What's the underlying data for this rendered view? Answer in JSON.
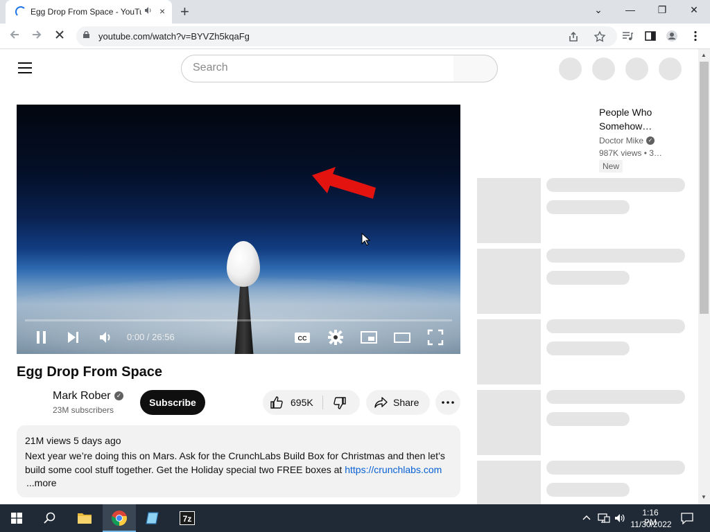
{
  "browser": {
    "tab_title": "Egg Drop From Space - YouTube",
    "tab_close": "×",
    "new_tab": "+",
    "url": "youtube.com/watch?v=BYVZh5kqaFg",
    "window_controls": {
      "dropdown": "⌄",
      "minimize": "—",
      "restore": "❐",
      "close": "✕"
    }
  },
  "youtube": {
    "search": {
      "placeholder": "Search"
    },
    "video": {
      "time": "0:00 / 26:56",
      "progress_fraction": 0.0,
      "title": "Egg Drop From Space"
    },
    "channel": {
      "name": "Mark Rober",
      "verified_mark": "✓",
      "subscribers": "23M subscribers"
    },
    "actions": {
      "subscribe": "Subscribe",
      "likes": "695K",
      "share": "Share"
    },
    "description": {
      "meta": "21M views  5 days ago",
      "line1": "Next year we’re doing this on Mars.  Ask for the CrunchLabs Build Box for Christmas and then let’s build some cool stuff together. Get the Holiday special two FREE boxes at ",
      "link": "https://crunchlabs.com",
      "more": "...more"
    },
    "recommendation": {
      "title": "People Who Somehow…",
      "channel": "Doctor Mike",
      "verified_mark": "✓",
      "stats": "987K views  • 3…",
      "badge": "New"
    }
  },
  "taskbar": {
    "time": "1:16 PM",
    "date": "11/30/2022"
  },
  "scrollbar": {
    "up": "▲",
    "down": "▼"
  }
}
